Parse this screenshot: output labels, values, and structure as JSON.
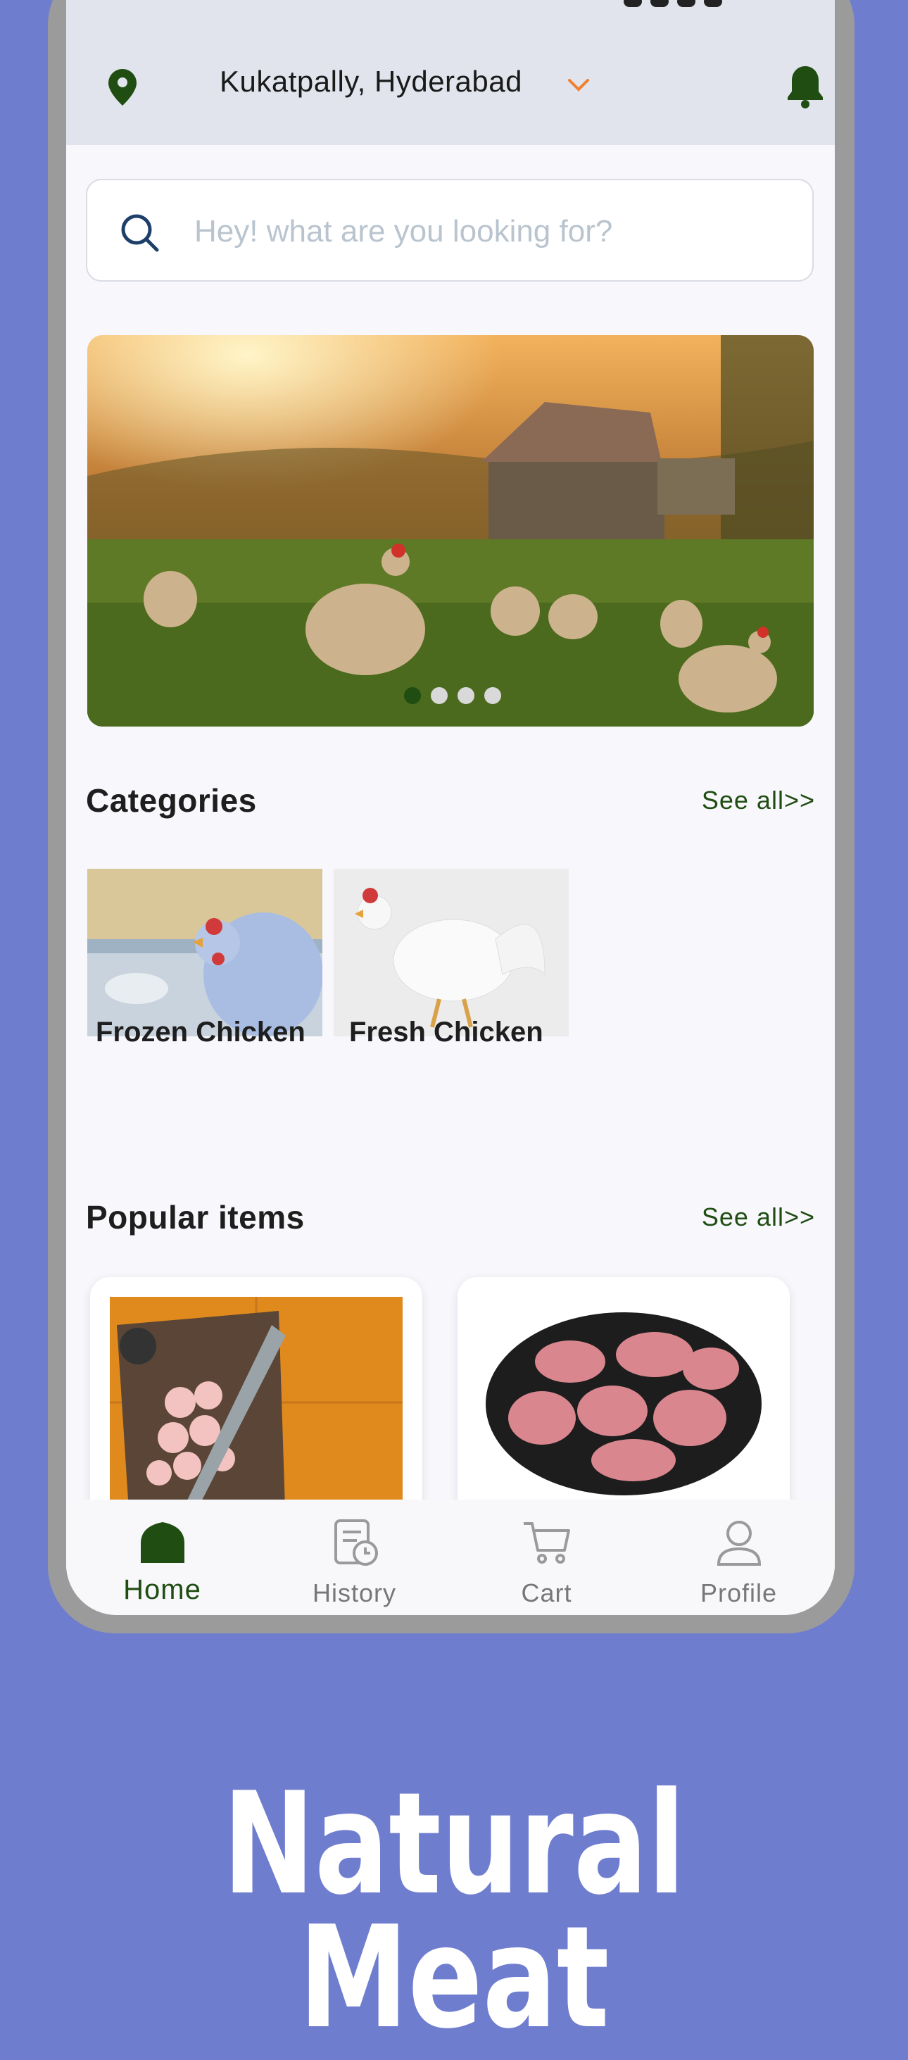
{
  "header": {
    "location_label": "Kukatpally, Hyderabad",
    "icons": {
      "location": "location-pin-icon",
      "dropdown": "chevron-down-icon",
      "notifications": "bell-icon"
    }
  },
  "search": {
    "placeholder": "Hey! what are you looking for?",
    "value": ""
  },
  "banner": {
    "slides_count": 4,
    "active_slide": 1
  },
  "categories": {
    "title": "Categories",
    "see_all": "See all>>",
    "items": [
      {
        "label": "Frozen Chicken"
      },
      {
        "label": "Fresh Chicken"
      }
    ]
  },
  "popular": {
    "title": "Popular items",
    "see_all": "See all>>"
  },
  "nav": {
    "items": [
      {
        "label": "Home",
        "icon": "home-icon",
        "active": true
      },
      {
        "label": "History",
        "icon": "history-icon",
        "active": false
      },
      {
        "label": "Cart",
        "icon": "cart-icon",
        "active": false
      },
      {
        "label": "Profile",
        "icon": "profile-icon",
        "active": false
      }
    ]
  },
  "promo": {
    "line1": "Natural",
    "line2": "Meat"
  },
  "colors": {
    "background": "#6f7dcf",
    "accent_green": "#1f4d12",
    "accent_orange": "#f08030"
  }
}
